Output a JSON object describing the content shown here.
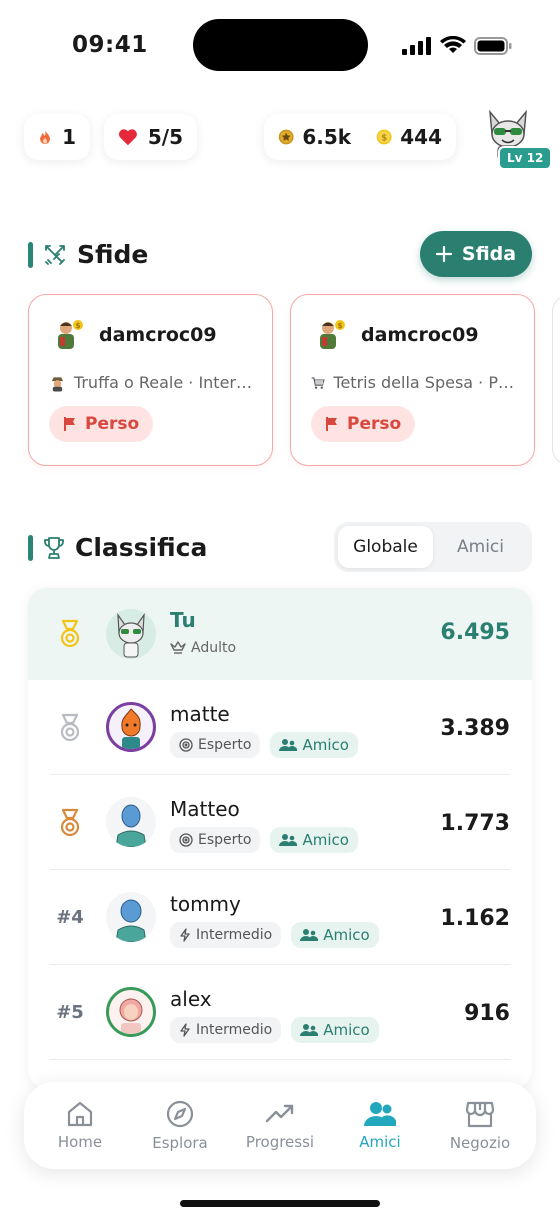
{
  "status_bar": {
    "time": "09:41"
  },
  "stats": {
    "streak": "1",
    "lives": "5/5",
    "stars": "6.5k",
    "coins": "444"
  },
  "profile": {
    "level": "Lv 12"
  },
  "challenges": {
    "title": "Sfide",
    "new_button": "Sfida",
    "cards": [
      {
        "user": "damcroc09",
        "game": "Truffa o Reale · Inter…",
        "result": "Perso"
      },
      {
        "user": "damcroc09",
        "game": "Tetris della Spesa · P…",
        "result": "Perso"
      }
    ]
  },
  "leaderboard": {
    "title": "Classifica",
    "tabs": [
      "Globale",
      "Amici"
    ],
    "active_tab": "Globale",
    "rows": [
      {
        "rank": "",
        "name": "Tu",
        "level": "Adulto",
        "friend": "",
        "score": "6.495"
      },
      {
        "rank": "",
        "name": "matte",
        "level": "Esperto",
        "friend": "Amico",
        "score": "3.389"
      },
      {
        "rank": "",
        "name": "Matteo",
        "level": "Esperto",
        "friend": "Amico",
        "score": "1.773"
      },
      {
        "rank": "#4",
        "name": "tommy",
        "level": "Intermedio",
        "friend": "Amico",
        "score": "1.162"
      },
      {
        "rank": "#5",
        "name": "alex",
        "level": "Intermedio",
        "friend": "Amico",
        "score": "916"
      }
    ]
  },
  "nav": {
    "items": [
      "Home",
      "Esplora",
      "Progressi",
      "Amici",
      "Negozio"
    ],
    "active": "Amici"
  },
  "colors": {
    "accent": "#2a7f70",
    "nav_active": "#22a8bd",
    "lost": "#d9483f",
    "gold": "#f2c418",
    "silver": "#b8bcc2",
    "bronze": "#d88a3c"
  }
}
